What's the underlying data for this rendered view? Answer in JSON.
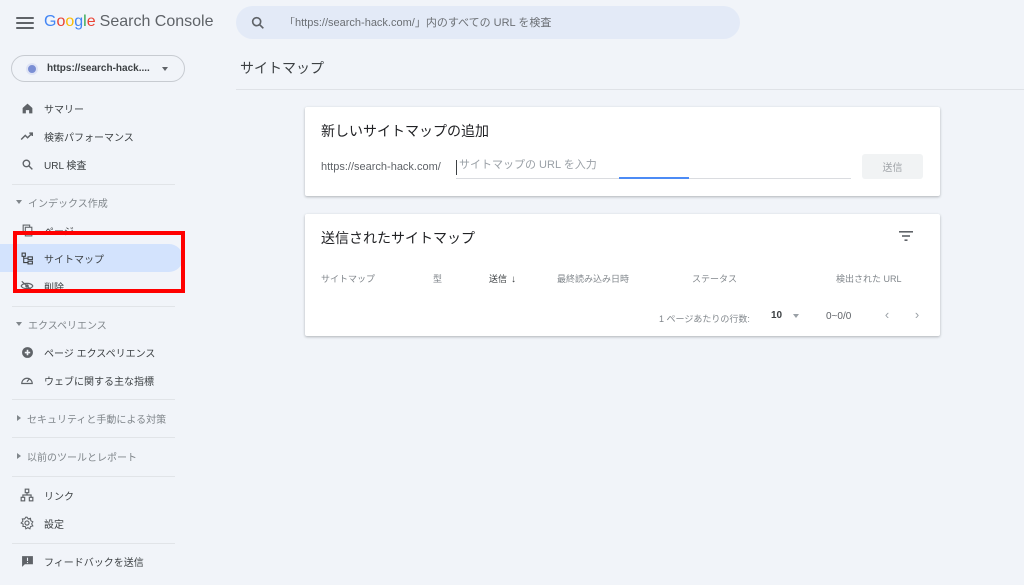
{
  "header": {
    "logo": {
      "letters": [
        "G",
        "o",
        "o",
        "g",
        "l",
        "e"
      ],
      "product": "Search Console"
    },
    "search": {
      "placeholder": "「https://search-hack.com/」内のすべての URL を検査",
      "value": ""
    }
  },
  "property": {
    "label": "https://search-hack...."
  },
  "sidebar": {
    "items": [
      {
        "label": "サマリー",
        "icon": "home-icon"
      },
      {
        "label": "検索パフォーマンス",
        "icon": "trending-up-icon"
      },
      {
        "label": "URL 検査",
        "icon": "search-icon"
      }
    ],
    "sections": [
      {
        "label": "インデックス作成",
        "expanded": true,
        "items": [
          {
            "label": "ページ",
            "icon": "page-icon"
          },
          {
            "label": "サイトマップ",
            "icon": "sitemap-icon",
            "active": true
          },
          {
            "label": "削除",
            "icon": "visibility-off-icon"
          }
        ]
      },
      {
        "label": "エクスペリエンス",
        "expanded": true,
        "items": [
          {
            "label": "ページ エクスペリエンス",
            "icon": "plus-circle-icon"
          },
          {
            "label": "ウェブに関する主な指標",
            "icon": "speed-gauge-icon"
          }
        ]
      },
      {
        "label": "セキュリティと手動による対策",
        "expanded": false
      },
      {
        "label": "以前のツールとレポート",
        "expanded": false
      }
    ],
    "bottom_items": [
      {
        "label": "リンク",
        "icon": "links-icon"
      },
      {
        "label": "設定",
        "icon": "gear-icon"
      },
      {
        "label": "フィードバックを送信",
        "icon": "feedback-icon"
      }
    ]
  },
  "main": {
    "page_title": "サイトマップ",
    "add_card": {
      "title": "新しいサイトマップの追加",
      "url_prefix": "https://search-hack.com/",
      "input_placeholder": "サイトマップの URL を入力",
      "input_value": "",
      "submit_label": "送信"
    },
    "submitted_card": {
      "title": "送信されたサイトマップ",
      "columns": [
        "サイトマップ",
        "型",
        "送信",
        "最終読み込み日時",
        "ステータス",
        "検出された URL"
      ],
      "sorted_column": "送信",
      "sort_direction": "desc",
      "rows": [],
      "pagination": {
        "rows_per_page_label": "1 ページあたりの行数:",
        "rows_per_page": "10",
        "range": "0~0/0"
      }
    }
  },
  "colors": {
    "background": "#f1f4f9",
    "active_nav": "#d3e3fd",
    "accent": "#4c8bf5",
    "annotation_box": "#ff0000"
  }
}
